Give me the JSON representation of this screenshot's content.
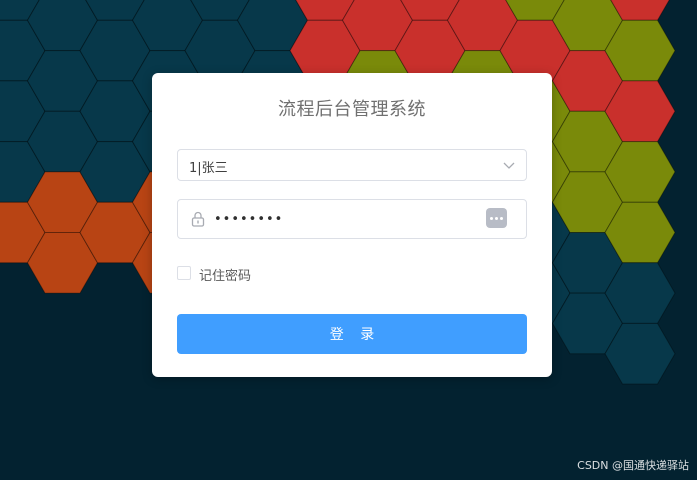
{
  "login": {
    "title": "流程后台管理系统",
    "account_select": {
      "value": "1|张三"
    },
    "password": {
      "value": "••••••••"
    },
    "remember": {
      "label": "记住密码",
      "checked": false
    },
    "submit_label": "登 录"
  },
  "watermark": "CSDN @国通快递驿站",
  "icons": {
    "select": "chevron-down-icon",
    "password": "lock-icon",
    "reveal": "password-reveal-icon"
  },
  "colors": {
    "background": "#032230",
    "hex_dark_teal": "#07384a",
    "hex_red": "#c9302c",
    "hex_olive": "#7a8a0a",
    "hex_orange": "#b84414",
    "hex_teal": "#2aa199",
    "primary_button": "#409eff"
  }
}
